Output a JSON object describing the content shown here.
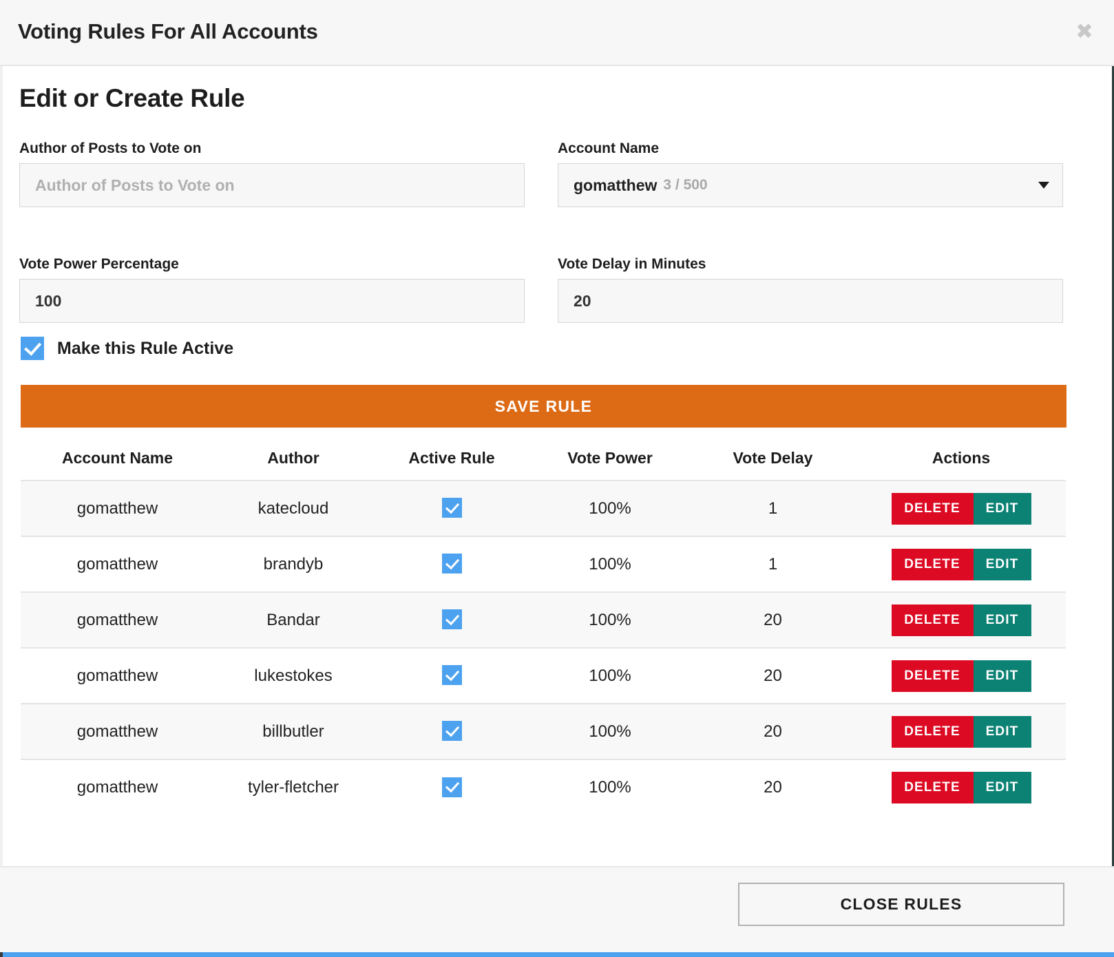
{
  "header": {
    "title": "Voting Rules For All Accounts",
    "close_icon": "close-icon",
    "close_glyph": "✖"
  },
  "body": {
    "section_title": "Edit or Create Rule"
  },
  "form": {
    "author": {
      "label": "Author of Posts to Vote on",
      "placeholder": "Author of Posts to Vote on",
      "value": ""
    },
    "account_name": {
      "label": "Account Name",
      "value": "gomatthew",
      "count": "3 / 500",
      "icon": "chevron-down-icon"
    },
    "vote_power": {
      "label": "Vote Power Percentage",
      "value": "100",
      "placeholder": "Vote Power Percentage"
    },
    "vote_delay": {
      "label": "Vote Delay in Minutes",
      "value": "20",
      "placeholder": "Vote Delay in Minutes"
    },
    "active_checkbox": {
      "label": "Make this Rule Active",
      "checked": true
    },
    "save_button": "SAVE RULE"
  },
  "table": {
    "columns": [
      "Account Name",
      "Author",
      "Active Rule",
      "Vote Power",
      "Vote Delay",
      "Actions"
    ],
    "action_labels": {
      "delete": "DELETE",
      "edit": "EDIT"
    },
    "rows": [
      {
        "account": "gomatthew",
        "author": "katecloud",
        "active": true,
        "power": "100%",
        "delay": "1"
      },
      {
        "account": "gomatthew",
        "author": "brandyb",
        "active": true,
        "power": "100%",
        "delay": "1"
      },
      {
        "account": "gomatthew",
        "author": "Bandar",
        "active": true,
        "power": "100%",
        "delay": "20"
      },
      {
        "account": "gomatthew",
        "author": "lukestokes",
        "active": true,
        "power": "100%",
        "delay": "20"
      },
      {
        "account": "gomatthew",
        "author": "billbutler",
        "active": true,
        "power": "100%",
        "delay": "20"
      },
      {
        "account": "gomatthew",
        "author": "tyler-fletcher",
        "active": true,
        "power": "100%",
        "delay": "20"
      }
    ]
  },
  "footer": {
    "close_rules_button": "CLOSE RULES"
  },
  "colors": {
    "save_orange": "#dd6b15",
    "delete_red": "#dc0a23",
    "edit_teal": "#0c8274",
    "checkbox_blue": "#4da2f0",
    "accent_bar_blue": "#4da2f0"
  }
}
